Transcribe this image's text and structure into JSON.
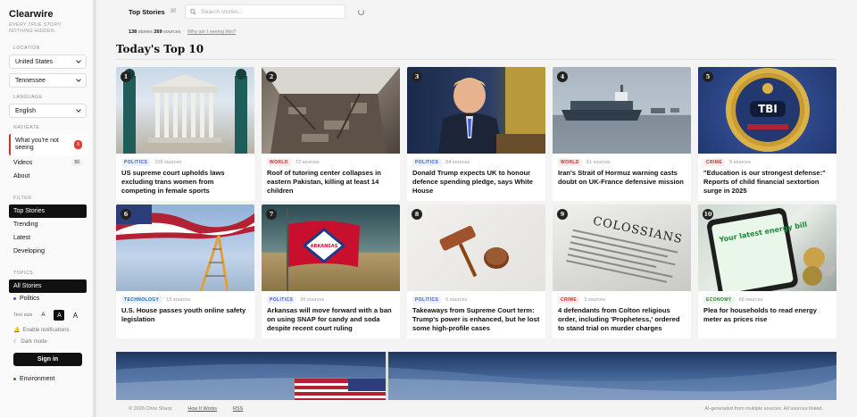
{
  "sidebar": {
    "brand": "Clearwire",
    "tagline": "EVERY TRUE STORY. NOTHING HIDDEN.",
    "location_label": "LOCATION",
    "country": "United States",
    "state": "Tennessee",
    "language_label": "LANGUAGE",
    "language": "English",
    "navigate_label": "NAVIGATE",
    "nav": [
      {
        "label": "What you're not seeing",
        "badge": "8"
      },
      {
        "label": "Videos",
        "badge": "50"
      },
      {
        "label": "About"
      }
    ],
    "filter_label": "FILTER",
    "filters": [
      "Top Stories",
      "Trending",
      "Latest",
      "Developing"
    ],
    "topics_label": "TOPICS",
    "topics": [
      "All Stories",
      "Politics"
    ],
    "text_size_label": "Text size",
    "text_sizes": [
      "A",
      "A",
      "A"
    ],
    "enable_notifications": "Enable notifications",
    "dark_mode": "Dark mode",
    "sign_in": "Sign in",
    "bottom_topic": "Environment"
  },
  "topbar": {
    "title": "Top Stories",
    "count": "30",
    "search_placeholder": "Search stories..."
  },
  "meta": {
    "stories_num": "138",
    "stories_word": "stories",
    "sources_num": "269",
    "sources_word": "sources",
    "why_link": "Why am I seeing this?"
  },
  "section_title": "Today's Top 10",
  "cards": [
    {
      "rank": "1",
      "category": "POLITICS",
      "cat_class": "politics",
      "sources": "109 sources",
      "headline": "US supreme court upholds laws excluding trans women from competing in female sports"
    },
    {
      "rank": "2",
      "category": "WORLD",
      "cat_class": "world",
      "sources": "72 sources",
      "headline": "Roof of tutoring center collapses in eastern Pakistan, killing at least 14 children"
    },
    {
      "rank": "3",
      "category": "POLITICS",
      "cat_class": "politics",
      "sources": "64 sources",
      "headline": "Donald Trump expects UK to honour defence spending pledge, says White House"
    },
    {
      "rank": "4",
      "category": "WORLD",
      "cat_class": "world",
      "sources": "61 sources",
      "headline": "Iran's Strait of Hormuz warning casts doubt on UK-France defensive mission"
    },
    {
      "rank": "5",
      "category": "CRIME",
      "cat_class": "crime",
      "sources": "5 sources",
      "headline": "\"Education is our strongest defense:\" Reports of child financial sextortion surge in 2025"
    },
    {
      "rank": "6",
      "category": "TECHNOLOGY",
      "cat_class": "technology",
      "sources": "15 sources",
      "headline": "U.S. House passes youth online safety legislation"
    },
    {
      "rank": "7",
      "category": "POLITICS",
      "cat_class": "politics",
      "sources": "26 sources",
      "headline": "Arkansas will move forward with a ban on using SNAP for candy and soda despite recent court ruling"
    },
    {
      "rank": "8",
      "category": "POLITICS",
      "cat_class": "politics",
      "sources": "5 sources",
      "headline": "Takeaways from Supreme Court term: Trump's power is enhanced, but he lost some high-profile cases"
    },
    {
      "rank": "9",
      "category": "CRIME",
      "cat_class": "crime",
      "sources": "3 sources",
      "headline": "4 defendants from Colton religious order, including 'Prophetess,' ordered to stand trial on murder charges"
    },
    {
      "rank": "10",
      "category": "ECONOMY",
      "cat_class": "economy",
      "sources": "68 sources",
      "headline": "Plea for households to read energy meter as prices rise"
    }
  ],
  "thumb_text": {
    "tbi": "TBI",
    "arkansas": "ARKANSAS",
    "colossians": "COLOSSIANS",
    "energy": "Your latest energy bill"
  },
  "footer": {
    "copyright": "© 2026 Chris Sharp",
    "how_it_works": "How It Works",
    "rss": "RSS",
    "disclaimer": "AI-generated from multiple sources. All sources linked."
  }
}
